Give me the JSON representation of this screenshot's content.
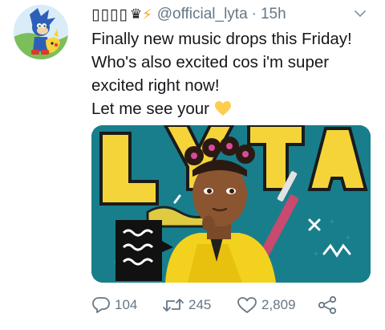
{
  "tweet": {
    "display_name": "▯▯▯▯",
    "name_glyph": "♛",
    "name_bolt": "⚡",
    "handle": "@official_lyta",
    "separator": "·",
    "time": "15h",
    "text_lines": [
      "Finally new music drops this Friday!",
      "Who's also excited cos i'm super",
      "excited right now!",
      "Let me see your"
    ],
    "emoji": "💛",
    "media_text": "LYTA",
    "stats": {
      "replies": "104",
      "retweets": "245",
      "likes": "2,809"
    }
  },
  "icons": {
    "reply": "reply-icon",
    "retweet": "retweet-icon",
    "like": "heart-icon",
    "share": "share-icon",
    "menu": "chevron-down-icon"
  },
  "colors": {
    "text": "#14171a",
    "secondary": "#657786",
    "bolt": "#f6a623",
    "heart_emoji": "#ffcc4d"
  }
}
